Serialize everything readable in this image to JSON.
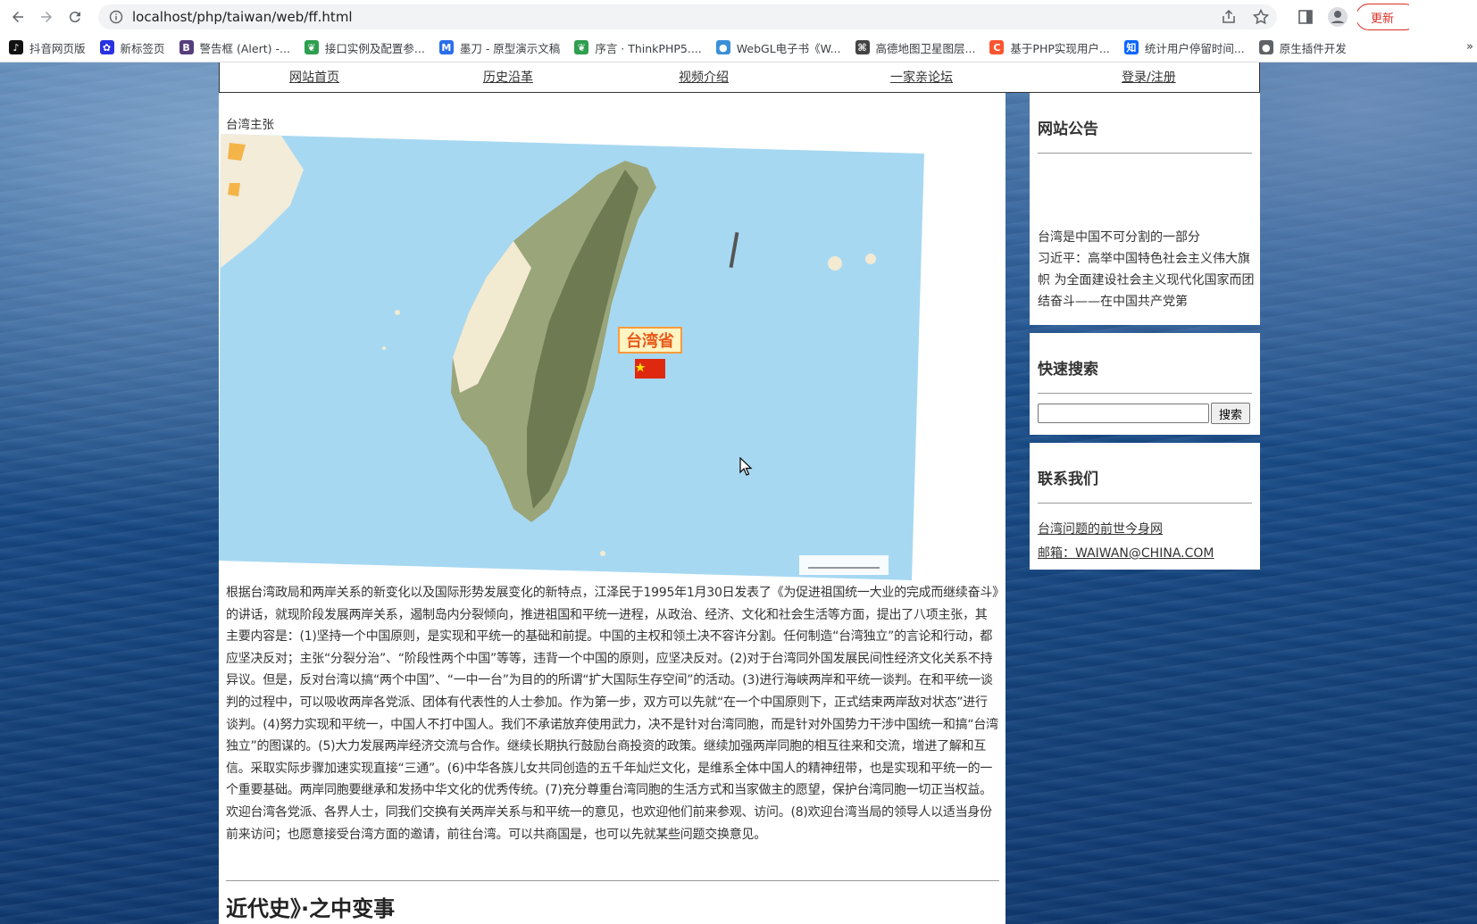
{
  "browser": {
    "url": "localhost/php/taiwan/web/ff.html",
    "update_label": "更新",
    "bookmarks": [
      {
        "label": "抖音网页版",
        "icon": "tiktok-icon",
        "color": "#111111"
      },
      {
        "label": "新标签页",
        "icon": "baidu-paw-icon",
        "color": "#2932e1"
      },
      {
        "label": "警告框 (Alert) -...",
        "icon": "bootstrap-icon",
        "color": "#563d7c"
      },
      {
        "label": "接口实例及配置参...",
        "icon": "leaf-icon",
        "color": "#2e9e4f"
      },
      {
        "label": "墨刀 - 原型演示文稿",
        "icon": "modao-icon",
        "color": "#2a6ee8"
      },
      {
        "label": "序言 · ThinkPHP5....",
        "icon": "leaf-icon",
        "color": "#2e9e4f"
      },
      {
        "label": "WebGL电子书《W...",
        "icon": "globe-icon",
        "color": "#3a8fd8"
      },
      {
        "label": "高德地图卫星图层...",
        "icon": "amap-icon",
        "color": "#444444"
      },
      {
        "label": "基于PHP实现用户...",
        "icon": "csdn-icon",
        "color": "#fc5531"
      },
      {
        "label": "统计用户停留时间...",
        "icon": "zhihu-icon",
        "color": "#0a66ff"
      },
      {
        "label": "原生插件开发",
        "icon": "globe-icon",
        "color": "#5f6368"
      }
    ],
    "more_label": "»"
  },
  "nav": {
    "items": [
      "网站首页",
      "历史沿革",
      "视频介绍",
      "一家亲论坛",
      "登录/注册"
    ]
  },
  "main": {
    "section_title": "台湾主张",
    "map": {
      "province_label": "台湾省"
    },
    "article_text": "根据台湾政局和两岸关系的新变化以及国际形势发展变化的新特点，江泽民于1995年1月30日发表了《为促进祖国统一大业的完成而继续奋斗》的讲话，就现阶段发展两岸关系，遏制岛内分裂倾向，推进祖国和平统一进程，从政治、经济、文化和社会生活等方面，提出了八项主张，其主要内容是：(1)坚持一个中国原则，是实现和平统一的基础和前提。中国的主权和领土决不容许分割。任何制造“台湾独立”的言论和行动，都应坚决反对；主张“分裂分治”、“阶段性两个中国”等等，违背一个中国的原则，应坚决反对。(2)对于台湾同外国发展民间性经济文化关系不持异议。但是，反对台湾以搞“两个中国”、“一中一台”为目的的所谓“扩大国际生存空间”的活动。(3)进行海峡两岸和平统一谈判。在和平统一谈判的过程中，可以吸收两岸各党派、团体有代表性的人士参加。作为第一步，双方可以先就“在一个中国原则下，正式结束两岸敌对状态”进行谈判。(4)努力实现和平统一，中国人不打中国人。我们不承诺放弃使用武力，决不是针对台湾同胞，而是针对外国势力干涉中国统一和搞“台湾独立”的图谋的。(5)大力发展两岸经济交流与合作。继续长期执行鼓励台商投资的政策。继续加强两岸同胞的相互往来和交流，增进了解和互信。采取实际步骤加速实现直接“三通”。(6)中华各族儿女共同创造的五千年灿烂文化，是维系全体中国人的精神纽带，也是实现和平统一的一个重要基础。两岸同胞要继承和发扬中华文化的优秀传统。(7)充分尊重台湾同胞的生活方式和当家做主的愿望，保护台湾同胞一切正当权益。欢迎台湾各党派、各界人士，同我们交换有关两岸关系与和平统一的意见，也欢迎他们前来参观、访问。(8)欢迎台湾当局的领导人以适当身份前来访问；也愿意接受台湾方面的邀请，前往台湾。可以共商国是，也可以先就某些问题交换意见。",
    "next_heading": "近代史》·之中变事"
  },
  "sidebar": {
    "notice": {
      "title": "网站公告",
      "items": [
        "台湾是中国不可分割的一部分",
        "习近平：高举中国特色社会主义伟大旗帜 为全面建设社会主义现代化国家而团结奋斗——在中国共产党第"
      ]
    },
    "search": {
      "title": "快速搜索",
      "value": "",
      "button_label": "搜索"
    },
    "contact": {
      "title": "联系我们",
      "links": [
        "台湾问题的前世今身网",
        "邮箱：WAIWAN@CHINA.COM"
      ]
    }
  }
}
